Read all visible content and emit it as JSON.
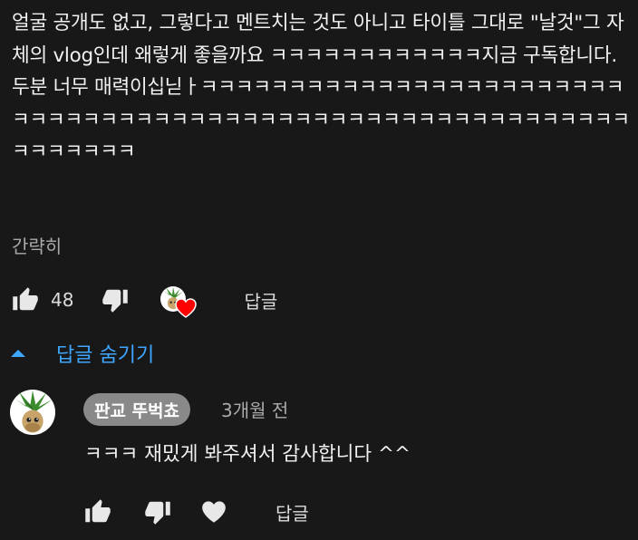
{
  "comment": {
    "text": "얼굴 공개도 없고, 그렇다고 멘트치는 것도 아니고 타이틀 그대로 \"날것\"그 자체의 vlog인데 왜렇게 좋을까요 ㅋㅋㅋㅋㅋㅋㅋㅋㅋㅋㅋㅋ지금 구독합니다. 두분 너무 매력이십닏ㅏㅋㅋㅋㅋㅋㅋㅋㅋㅋㅋㅋㅋㅋㅋㅋㅋㅋㅋㅋㅋㅋㅋㅋㅋㅋㅋㅋㅋㅋㅋㅋㅋㅋㅋㅋㅋㅋㅋㅋㅋㅋㅋㅋㅋㅋㅋㅋㅋㅋㅋㅋㅋㅋㅋㅋㅋㅋㅋㅋㅋㅋㅋㅋㅋㅋㅋ",
    "collapse_label": "간략히",
    "like_count": "48",
    "reply_label": "답글"
  },
  "replies_toggle": {
    "label": "답글 숨기기"
  },
  "reply": {
    "author": "판교 뚜벅쵸",
    "time": "3개월 전",
    "text": "ㅋㅋㅋ 재밌게 봐주셔서 감사합니다 ^^",
    "reply_label": "답글"
  },
  "colors": {
    "background": "#181818",
    "link_blue": "#3ea6ff",
    "heart_red": "#ff0000",
    "chip_gray": "#898989"
  },
  "icons": [
    "thumb-up-icon",
    "thumb-down-icon",
    "creator-heart-icon",
    "caret-up-icon",
    "heart-icon"
  ]
}
